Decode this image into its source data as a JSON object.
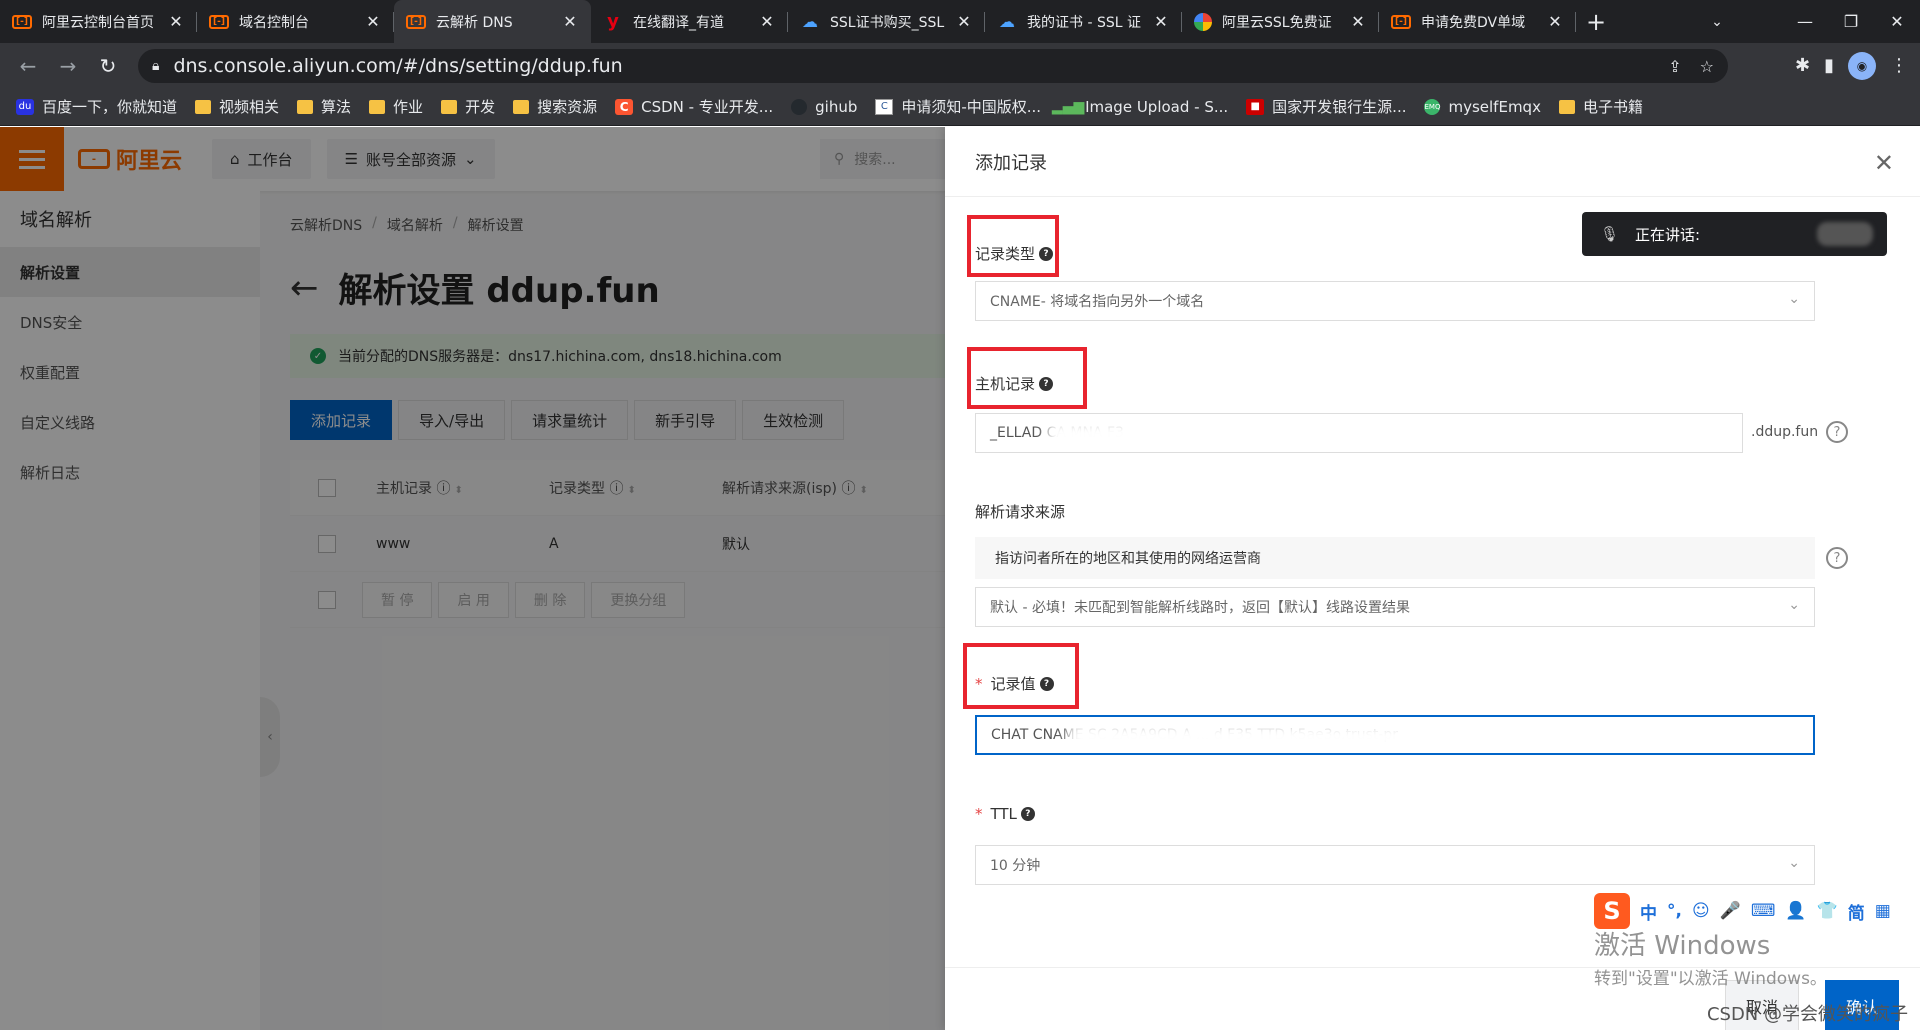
{
  "browser": {
    "tabs": [
      {
        "title": "阿里云控制台首页",
        "icon": "aliyun-icon",
        "active": false
      },
      {
        "title": "域名控制台",
        "icon": "aliyun-icon",
        "active": false
      },
      {
        "title": "云解析 DNS",
        "icon": "aliyun-icon",
        "active": true
      },
      {
        "title": "在线翻译_有道",
        "icon": "youdao-icon",
        "active": false
      },
      {
        "title": "SSL证书购买_SSL",
        "icon": "cloud-icon",
        "active": false
      },
      {
        "title": "我的证书 - SSL 证",
        "icon": "cloud-icon",
        "active": false
      },
      {
        "title": "阿里云SSL免费证",
        "icon": "google-icon",
        "active": false
      },
      {
        "title": "申请免费DV单域",
        "icon": "aliyun-icon",
        "active": false
      }
    ],
    "close_glyph": "✕",
    "new_tab_glyph": "+",
    "url": "dns.console.aliyun.com/#/dns/setting/ddup.fun",
    "bookmarks": [
      {
        "label": "百度一下，你就知道",
        "icon": "baidu-icon"
      },
      {
        "label": "视频相关",
        "icon": "folder-icon"
      },
      {
        "label": "算法",
        "icon": "folder-icon"
      },
      {
        "label": "作业",
        "icon": "folder-icon"
      },
      {
        "label": "开发",
        "icon": "folder-icon"
      },
      {
        "label": "搜索资源",
        "icon": "folder-icon"
      },
      {
        "label": "CSDN - 专业开发...",
        "icon": "csdn-icon"
      },
      {
        "label": "gihub",
        "icon": "github-icon"
      },
      {
        "label": "申请须知-中国版权...",
        "icon": "doc-icon"
      },
      {
        "label": "Image Upload - S...",
        "icon": "bars-icon"
      },
      {
        "label": "国家开发银行生源...",
        "icon": "bank-icon"
      },
      {
        "label": "myselfEmqx",
        "icon": "emqx-icon"
      },
      {
        "label": "电子书籍",
        "icon": "folder-icon"
      }
    ]
  },
  "console": {
    "logo_text": "阿里云",
    "workbench": "工作台",
    "resources": "账号全部资源",
    "search_placeholder": "搜索...",
    "sidebar": {
      "title": "域名解析",
      "items": [
        "解析设置",
        "DNS安全",
        "权重配置",
        "自定义线路",
        "解析日志"
      ]
    },
    "breadcrumb": [
      "云解析DNS",
      "域名解析",
      "解析设置"
    ],
    "page_title": "解析设置 ddup.fun",
    "dns_alert": "当前分配的DNS服务器是：dns17.hichina.com, dns18.hichina.com",
    "actions": [
      "添加记录",
      "导入/导出",
      "请求量统计",
      "新手引导",
      "生效检测"
    ],
    "table": {
      "headers": [
        "主机记录",
        "记录类型",
        "解析请求来源(isp)"
      ],
      "rows": [
        [
          "www",
          "A",
          "默认"
        ]
      ]
    },
    "bulk_actions": [
      "暂 停",
      "启 用",
      "删 除",
      "更换分组"
    ]
  },
  "drawer": {
    "title": "添加记录",
    "record_type_label": "记录类型",
    "record_type_value": "CNAME- 将域名指向另外一个域名",
    "host_label": "主机记录",
    "host_value": "_ELLAD    CA                    MNA              F3",
    "host_suffix": ".ddup.fun",
    "source_label": "解析请求来源",
    "source_info": "指访问者所在的地区和其使用的网络运营商",
    "source_value": "默认 - 必填！未匹配到智能解析线路时，返回【默认】线路设置结果",
    "value_label": "记录值",
    "value_value": "CHAT           CNAME        SC   2A5A9CD A   ...   d  F35                        TTD   k5ae3o.trust-pr",
    "ttl_label": "TTL",
    "ttl_value": "10 分钟",
    "cancel": "取消",
    "confirm": "确认"
  },
  "overlay_widgets": {
    "speaking": "正在讲话:",
    "ime_items": [
      "中",
      "°,",
      "☺",
      "🎤",
      "⌨",
      "👤",
      "👕",
      "简",
      "▦"
    ],
    "activation_title": "激活 Windows",
    "activation_sub": "转到\"设置\"以激活 Windows。",
    "csdn_watermark": "CSDN @学会微笑的疯子"
  },
  "colors": {
    "aliyun_orange": "#ff6a00",
    "primary_blue": "#0064c8",
    "highlight_red": "#e8242e"
  }
}
